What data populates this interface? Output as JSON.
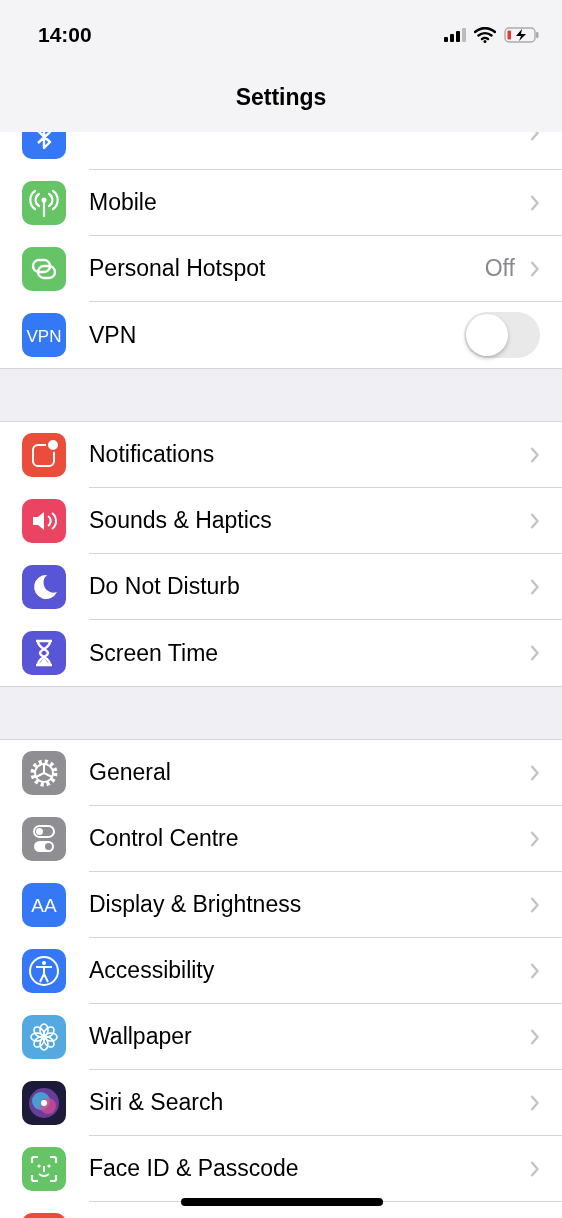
{
  "status_bar": {
    "time": "14:00"
  },
  "title": "Settings",
  "groups": [
    {
      "items": [
        {
          "kind": "chevron",
          "clipped": true
        },
        {
          "label": "Mobile",
          "kind": "chevron"
        },
        {
          "label": "Personal Hotspot",
          "value": "Off",
          "kind": "chevron"
        },
        {
          "icon_text": "VPN",
          "label": "VPN",
          "kind": "toggle",
          "on": false
        }
      ]
    },
    {
      "items": [
        {
          "label": "Notifications",
          "kind": "chevron"
        },
        {
          "label": "Sounds & Haptics",
          "kind": "chevron"
        },
        {
          "label": "Do Not Disturb",
          "kind": "chevron"
        },
        {
          "label": "Screen Time",
          "kind": "chevron"
        }
      ]
    },
    {
      "items": [
        {
          "label": "General",
          "kind": "chevron"
        },
        {
          "label": "Control Centre",
          "kind": "chevron"
        },
        {
          "icon_text": "AA",
          "label": "Display & Brightness",
          "kind": "chevron"
        },
        {
          "label": "Accessibility",
          "kind": "chevron"
        },
        {
          "label": "Wallpaper",
          "kind": "chevron"
        },
        {
          "label": "Siri & Search",
          "kind": "chevron"
        },
        {
          "label": "Face ID & Passcode",
          "kind": "chevron"
        },
        {
          "kind": "none",
          "clipped": true
        }
      ]
    }
  ]
}
